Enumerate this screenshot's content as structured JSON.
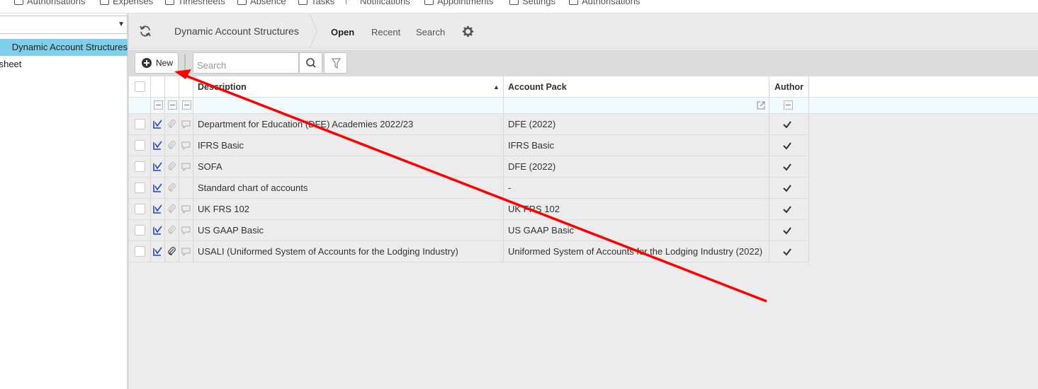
{
  "topnav": {
    "items": [
      {
        "label": "Authorisations"
      },
      {
        "label": "Expenses"
      },
      {
        "label": "Timesheets"
      },
      {
        "label": "Absence"
      },
      {
        "label": "Tasks"
      },
      {
        "label": "Notifications"
      },
      {
        "label": "Appointments"
      },
      {
        "label": "Settings"
      },
      {
        "label": "Authorisations"
      }
    ]
  },
  "sidebar": {
    "select_value": "",
    "items": [
      {
        "label": "Dynamic Account Structures",
        "active": true
      },
      {
        "label": "Balance sheet",
        "active": false
      }
    ]
  },
  "header": {
    "breadcrumb": "Dynamic Account Structures",
    "tabs": [
      {
        "label": "Open",
        "active": true
      },
      {
        "label": "Recent",
        "active": false
      },
      {
        "label": "Search",
        "active": false
      }
    ]
  },
  "toolbar": {
    "new_label": "New",
    "search_placeholder": "Search"
  },
  "grid": {
    "columns": {
      "description": "Description",
      "account_pack": "Account Pack",
      "author": "Author"
    },
    "rows": [
      {
        "description": "Department for Education (DFE) Academies 2022/23",
        "account_pack": "DFE (2022)",
        "has_attachment": false,
        "has_note": true
      },
      {
        "description": "IFRS Basic",
        "account_pack": "IFRS Basic",
        "has_attachment": false,
        "has_note": true
      },
      {
        "description": "SOFA",
        "account_pack": "DFE (2022)",
        "has_attachment": false,
        "has_note": true
      },
      {
        "description": "Standard chart of accounts",
        "account_pack": "-",
        "has_attachment": false,
        "has_note": false
      },
      {
        "description": "UK FRS 102",
        "account_pack": "UK FRS 102",
        "has_attachment": false,
        "has_note": true
      },
      {
        "description": "US GAAP Basic",
        "account_pack": "US GAAP Basic",
        "has_attachment": false,
        "has_note": true
      },
      {
        "description": "USALI (Uniformed System of Accounts for the Lodging Industry)",
        "account_pack": "Uniformed System of Accounts for the Lodging Industry (2022)",
        "has_attachment": true,
        "has_note": true
      }
    ]
  },
  "colors": {
    "active_sidebar": "#7ecfe9",
    "annotation_arrow": "#ff0000",
    "edit_icon": "#1a3fd6"
  }
}
